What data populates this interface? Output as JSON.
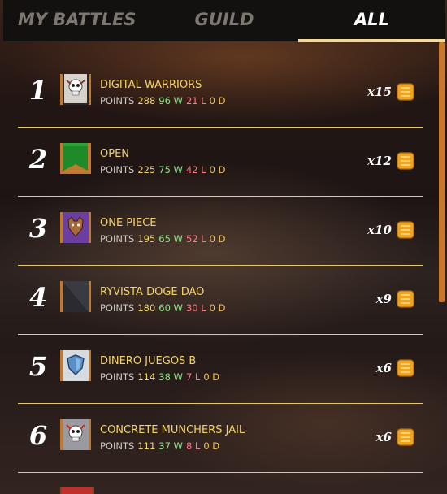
{
  "tabs": [
    {
      "label": "MY BATTLES",
      "active": false
    },
    {
      "label": "GUILD",
      "active": false
    },
    {
      "label": "ALL",
      "active": true
    }
  ],
  "points_label": "POINTS",
  "rows": [
    {
      "rank": "1",
      "name": "DIGITAL WARRIORS",
      "points": "288",
      "wins": "96 W",
      "losses": "21 L",
      "draws": "0 D",
      "multiplier": "x15",
      "banner": "skull-crest",
      "banner_color": "#e8a34a"
    },
    {
      "rank": "2",
      "name": "OPEN",
      "points": "225",
      "wins": "75 W",
      "losses": "42 L",
      "draws": "0 D",
      "multiplier": "x12",
      "banner": "plain-green",
      "banner_color": "#1f8a2a"
    },
    {
      "rank": "3",
      "name": "ONE PIECE",
      "points": "195",
      "wins": "65 W",
      "losses": "52 L",
      "draws": "0 D",
      "multiplier": "x10",
      "banner": "wolf-crest",
      "banner_color": "#6a3fa0"
    },
    {
      "rank": "4",
      "name": "RYVISTA DOGE DAO",
      "points": "180",
      "wins": "60 W",
      "losses": "30 L",
      "draws": "0 D",
      "multiplier": "x9",
      "banner": "plain-dark",
      "banner_color": "#2a2a30"
    },
    {
      "rank": "5",
      "name": "DINERO JUEGOS B",
      "points": "114",
      "wins": "38 W",
      "losses": "7 L",
      "draws": "0 D",
      "multiplier": "x6",
      "banner": "shield-crest",
      "banner_color": "#3a6fa8"
    },
    {
      "rank": "6",
      "name": "CONCRETE MUNCHERS JAIL",
      "points": "111",
      "wins": "37 W",
      "losses": "8 L",
      "draws": "0 D",
      "multiplier": "x6",
      "banner": "skull-crest",
      "banner_color": "#9a9aa0"
    }
  ]
}
